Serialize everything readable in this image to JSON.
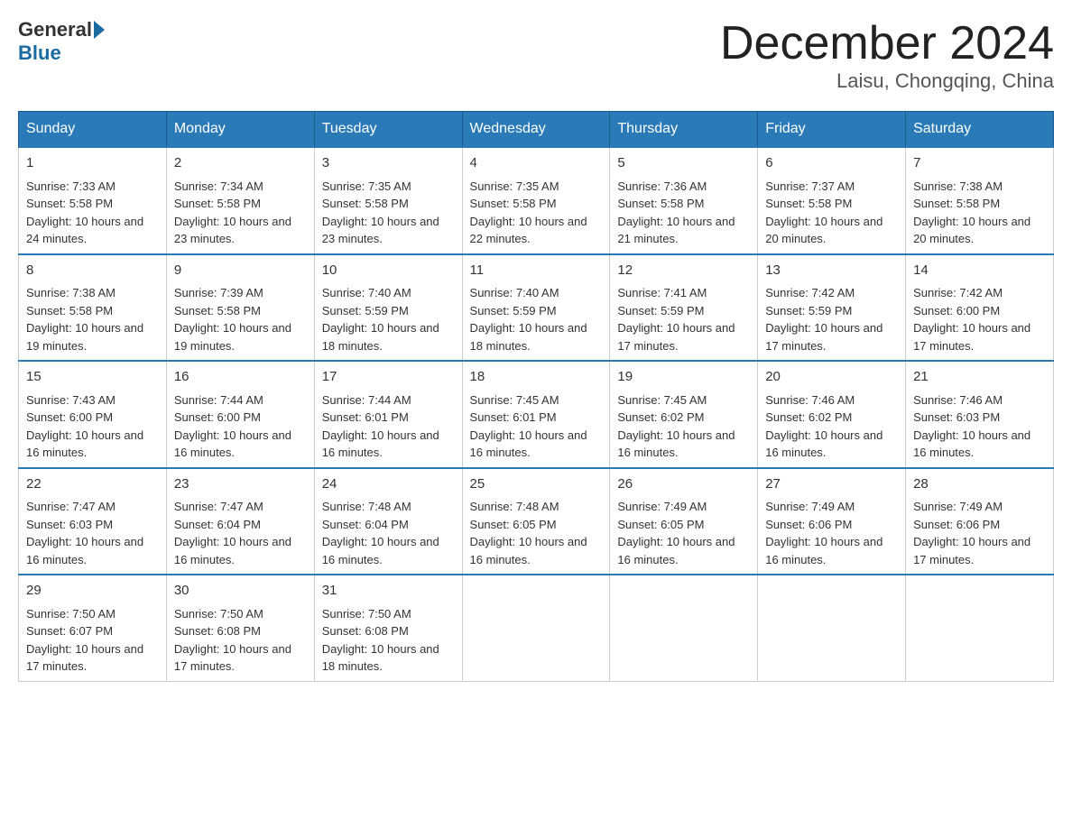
{
  "logo": {
    "general": "General",
    "blue": "Blue"
  },
  "title": "December 2024",
  "subtitle": "Laisu, Chongqing, China",
  "days": [
    "Sunday",
    "Monday",
    "Tuesday",
    "Wednesday",
    "Thursday",
    "Friday",
    "Saturday"
  ],
  "weeks": [
    [
      {
        "num": "1",
        "sunrise": "7:33 AM",
        "sunset": "5:58 PM",
        "daylight": "10 hours and 24 minutes."
      },
      {
        "num": "2",
        "sunrise": "7:34 AM",
        "sunset": "5:58 PM",
        "daylight": "10 hours and 23 minutes."
      },
      {
        "num": "3",
        "sunrise": "7:35 AM",
        "sunset": "5:58 PM",
        "daylight": "10 hours and 23 minutes."
      },
      {
        "num": "4",
        "sunrise": "7:35 AM",
        "sunset": "5:58 PM",
        "daylight": "10 hours and 22 minutes."
      },
      {
        "num": "5",
        "sunrise": "7:36 AM",
        "sunset": "5:58 PM",
        "daylight": "10 hours and 21 minutes."
      },
      {
        "num": "6",
        "sunrise": "7:37 AM",
        "sunset": "5:58 PM",
        "daylight": "10 hours and 20 minutes."
      },
      {
        "num": "7",
        "sunrise": "7:38 AM",
        "sunset": "5:58 PM",
        "daylight": "10 hours and 20 minutes."
      }
    ],
    [
      {
        "num": "8",
        "sunrise": "7:38 AM",
        "sunset": "5:58 PM",
        "daylight": "10 hours and 19 minutes."
      },
      {
        "num": "9",
        "sunrise": "7:39 AM",
        "sunset": "5:58 PM",
        "daylight": "10 hours and 19 minutes."
      },
      {
        "num": "10",
        "sunrise": "7:40 AM",
        "sunset": "5:59 PM",
        "daylight": "10 hours and 18 minutes."
      },
      {
        "num": "11",
        "sunrise": "7:40 AM",
        "sunset": "5:59 PM",
        "daylight": "10 hours and 18 minutes."
      },
      {
        "num": "12",
        "sunrise": "7:41 AM",
        "sunset": "5:59 PM",
        "daylight": "10 hours and 17 minutes."
      },
      {
        "num": "13",
        "sunrise": "7:42 AM",
        "sunset": "5:59 PM",
        "daylight": "10 hours and 17 minutes."
      },
      {
        "num": "14",
        "sunrise": "7:42 AM",
        "sunset": "6:00 PM",
        "daylight": "10 hours and 17 minutes."
      }
    ],
    [
      {
        "num": "15",
        "sunrise": "7:43 AM",
        "sunset": "6:00 PM",
        "daylight": "10 hours and 16 minutes."
      },
      {
        "num": "16",
        "sunrise": "7:44 AM",
        "sunset": "6:00 PM",
        "daylight": "10 hours and 16 minutes."
      },
      {
        "num": "17",
        "sunrise": "7:44 AM",
        "sunset": "6:01 PM",
        "daylight": "10 hours and 16 minutes."
      },
      {
        "num": "18",
        "sunrise": "7:45 AM",
        "sunset": "6:01 PM",
        "daylight": "10 hours and 16 minutes."
      },
      {
        "num": "19",
        "sunrise": "7:45 AM",
        "sunset": "6:02 PM",
        "daylight": "10 hours and 16 minutes."
      },
      {
        "num": "20",
        "sunrise": "7:46 AM",
        "sunset": "6:02 PM",
        "daylight": "10 hours and 16 minutes."
      },
      {
        "num": "21",
        "sunrise": "7:46 AM",
        "sunset": "6:03 PM",
        "daylight": "10 hours and 16 minutes."
      }
    ],
    [
      {
        "num": "22",
        "sunrise": "7:47 AM",
        "sunset": "6:03 PM",
        "daylight": "10 hours and 16 minutes."
      },
      {
        "num": "23",
        "sunrise": "7:47 AM",
        "sunset": "6:04 PM",
        "daylight": "10 hours and 16 minutes."
      },
      {
        "num": "24",
        "sunrise": "7:48 AM",
        "sunset": "6:04 PM",
        "daylight": "10 hours and 16 minutes."
      },
      {
        "num": "25",
        "sunrise": "7:48 AM",
        "sunset": "6:05 PM",
        "daylight": "10 hours and 16 minutes."
      },
      {
        "num": "26",
        "sunrise": "7:49 AM",
        "sunset": "6:05 PM",
        "daylight": "10 hours and 16 minutes."
      },
      {
        "num": "27",
        "sunrise": "7:49 AM",
        "sunset": "6:06 PM",
        "daylight": "10 hours and 16 minutes."
      },
      {
        "num": "28",
        "sunrise": "7:49 AM",
        "sunset": "6:06 PM",
        "daylight": "10 hours and 17 minutes."
      }
    ],
    [
      {
        "num": "29",
        "sunrise": "7:50 AM",
        "sunset": "6:07 PM",
        "daylight": "10 hours and 17 minutes."
      },
      {
        "num": "30",
        "sunrise": "7:50 AM",
        "sunset": "6:08 PM",
        "daylight": "10 hours and 17 minutes."
      },
      {
        "num": "31",
        "sunrise": "7:50 AM",
        "sunset": "6:08 PM",
        "daylight": "10 hours and 18 minutes."
      },
      null,
      null,
      null,
      null
    ]
  ],
  "labels": {
    "sunrise": "Sunrise:",
    "sunset": "Sunset:",
    "daylight": "Daylight:"
  }
}
